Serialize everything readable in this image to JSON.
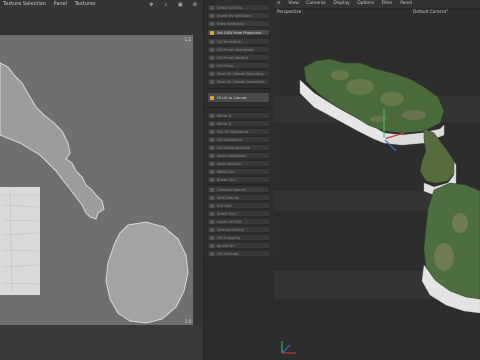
{
  "uv_editor": {
    "menu": [
      "Texture Selection",
      "Panel",
      "Textures"
    ],
    "toolbar_icons": [
      "move-icon",
      "zoom-icon",
      "maximize-icon",
      "settings-icon"
    ],
    "corner_top_right": "1,1",
    "corner_bottom_right": "1,0"
  },
  "panel": {
    "items_top": [
      "Select All UVs",
      "Invert UV Selection",
      "Grow Selection",
      "Set UVW from Projection",
      "UV Transform",
      "UV Mirror Horizontal",
      "UV Mirror Vertical",
      "UV Relax",
      "Pack UV Islands Bounding",
      "Pack UV Islands Geometric"
    ],
    "highlighted_items": [
      "Set UVW from Projection",
      "Fit UV to Canvas"
    ],
    "fit_item": "Fit UV to Canvas",
    "items_bottom": [
      "Mirror U",
      "Mirror V",
      "Flip UV Sequence",
      "UV Straighten",
      "UV Rectangularize",
      "Align Horizontal",
      "Align Vertical",
      "Weld UVs",
      "Break UVs",
      "Connect Islands",
      "Split Islands",
      "Cut UVs",
      "Stitch UVs",
      "Layer UV Edit",
      "Texture Seams",
      "UV Snapping",
      "Ignore UV",
      "UV Settings"
    ]
  },
  "viewport": {
    "menu": [
      "View",
      "Cameras",
      "Display",
      "Options",
      "Filter",
      "Panel"
    ],
    "view_name": "Perspective",
    "camera_name": "Default Camera°",
    "colors": {
      "terrain_green": "#4a6a3c",
      "cliff_white": "#e6e6e6",
      "axis_red": "#d23b3b",
      "axis_green": "#3bc45a",
      "axis_blue": "#3b6fd2"
    }
  }
}
